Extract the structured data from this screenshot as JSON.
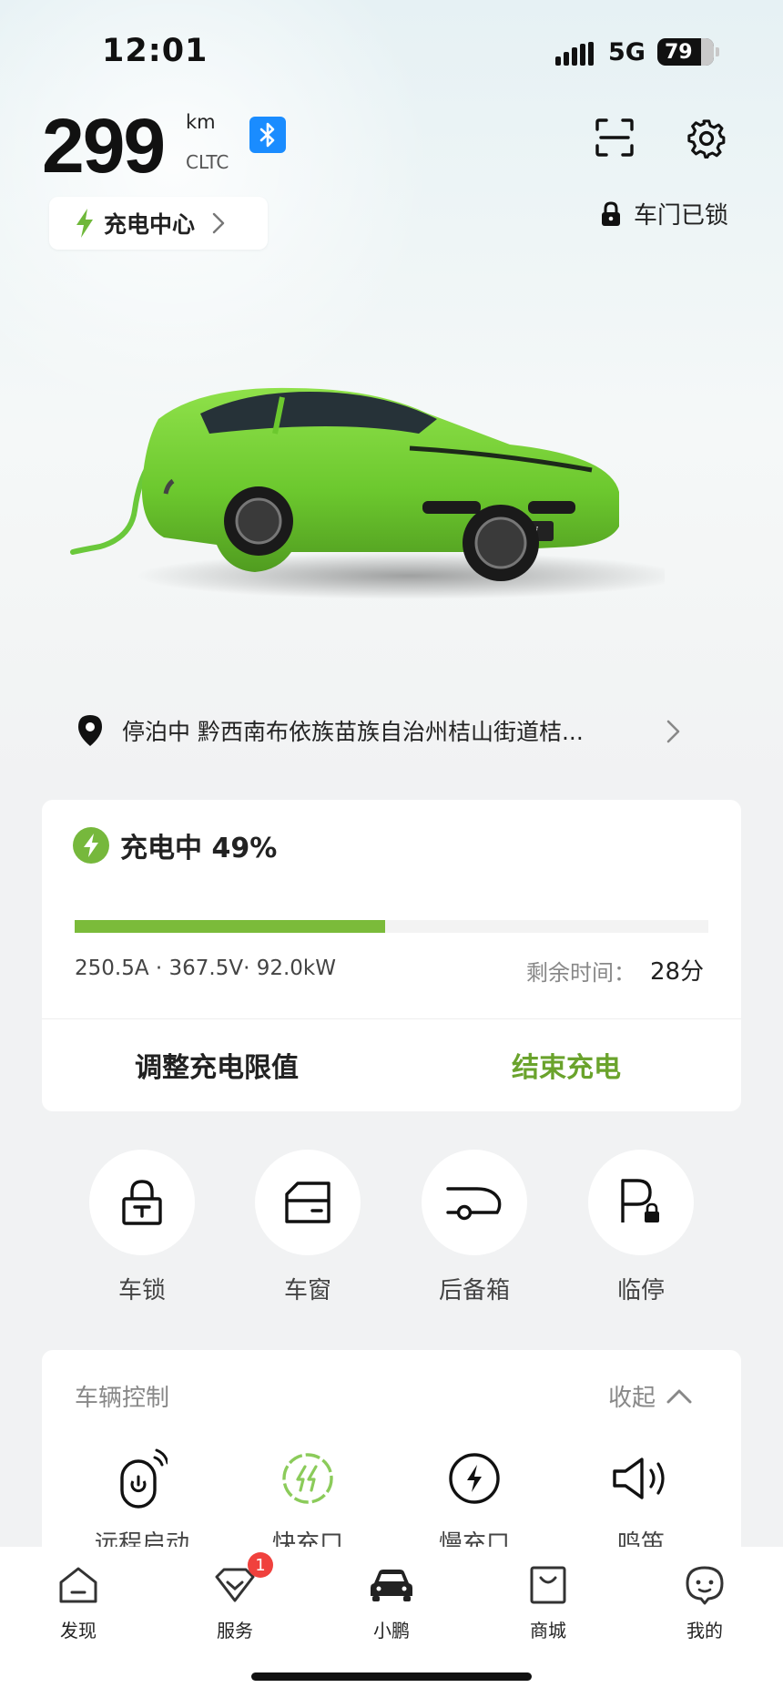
{
  "status_bar": {
    "time": "12:01",
    "network": "5G",
    "battery": "79"
  },
  "range": {
    "value": "299",
    "unit": "km",
    "standard": "CLTC"
  },
  "icons": {
    "bluetooth": "bluetooth-icon",
    "scan": "scan-icon",
    "settings": "gear-icon"
  },
  "charge_center": {
    "label": "充电中心"
  },
  "door_status": "车门已锁",
  "location": {
    "text": "停泊中 黔西南布依族苗族自治州桔山街道桔..."
  },
  "charging": {
    "status": "充电中 49%",
    "progress": 0.49,
    "specs": "250.5A · 367.5V· 92.0kW",
    "remaining_label": "剩余时间：",
    "remaining_value": "28分",
    "adjust_label": "调整充电限值",
    "end_label": "结束充电"
  },
  "quick_actions": [
    {
      "label": "车锁",
      "icon": "lock-icon"
    },
    {
      "label": "车窗",
      "icon": "window-icon"
    },
    {
      "label": "后备箱",
      "icon": "trunk-icon"
    },
    {
      "label": "临停",
      "icon": "parking-icon"
    }
  ],
  "vehicle_control": {
    "title": "车辆控制",
    "collapse_label": "收起",
    "items": [
      {
        "label": "远程启动",
        "icon": "remote-start-icon"
      },
      {
        "label": "快充口",
        "icon": "fast-charge-port-icon"
      },
      {
        "label": "慢充口",
        "icon": "slow-charge-port-icon"
      },
      {
        "label": "鸣笛",
        "icon": "horn-icon"
      }
    ]
  },
  "tabs": [
    {
      "label": "发现",
      "icon": "home-icon"
    },
    {
      "label": "服务",
      "icon": "service-icon",
      "badge": "1"
    },
    {
      "label": "小鹏",
      "icon": "car-icon"
    },
    {
      "label": "商城",
      "icon": "shop-icon"
    },
    {
      "label": "我的",
      "icon": "profile-icon"
    }
  ],
  "colors": {
    "accent_green": "#7bbb3a",
    "end_charge_green": "#6aa32c",
    "bluetooth_blue": "#1a8cff",
    "badge_red": "#f0413d"
  }
}
